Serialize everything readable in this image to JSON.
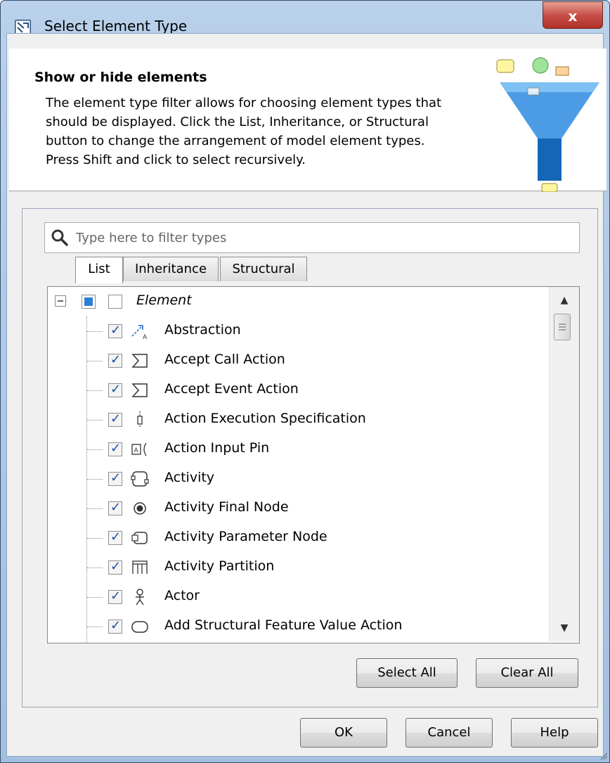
{
  "window": {
    "title": "Select Element Type",
    "close_label": "x"
  },
  "header": {
    "title": "Show or hide elements",
    "description": "The element type filter allows for choosing element types that should be displayed. Click the List, Inheritance, or Structural button to change the arrangement of model element types. Press Shift and click to select recursively."
  },
  "search": {
    "placeholder": "Type here to filter types",
    "value": ""
  },
  "tabs": [
    {
      "label": "List",
      "active": true
    },
    {
      "label": "Inheritance",
      "active": false
    },
    {
      "label": "Structural",
      "active": false
    }
  ],
  "tree": {
    "root": {
      "label": "Element",
      "expanded": true,
      "partial": true,
      "checked": false
    },
    "items": [
      {
        "label": "Abstraction",
        "icon": "abstraction-icon",
        "checked": true
      },
      {
        "label": "Accept Call Action",
        "icon": "accept-call-action-icon",
        "checked": true
      },
      {
        "label": "Accept Event Action",
        "icon": "accept-event-action-icon",
        "checked": true
      },
      {
        "label": "Action Execution Specification",
        "icon": "action-execution-specification-icon",
        "checked": true
      },
      {
        "label": "Action Input Pin",
        "icon": "action-input-pin-icon",
        "checked": true
      },
      {
        "label": "Activity",
        "icon": "activity-icon",
        "checked": true
      },
      {
        "label": "Activity Final Node",
        "icon": "activity-final-node-icon",
        "checked": true
      },
      {
        "label": "Activity Parameter Node",
        "icon": "activity-parameter-node-icon",
        "checked": true
      },
      {
        "label": "Activity Partition",
        "icon": "activity-partition-icon",
        "checked": true
      },
      {
        "label": "Actor",
        "icon": "actor-icon",
        "checked": true
      },
      {
        "label": "Add Structural Feature Value Action",
        "icon": "add-structural-feature-value-action-icon",
        "checked": true
      }
    ]
  },
  "buttons": {
    "select_all": "Select All",
    "clear_all": "Clear All",
    "ok": "OK",
    "cancel": "Cancel",
    "help": "Help"
  },
  "colors": {
    "title_bar": "#b9d1ea",
    "close_button": "#c7504a",
    "check_mark": "#1b4fa6",
    "funnel": "#1a73c7"
  }
}
